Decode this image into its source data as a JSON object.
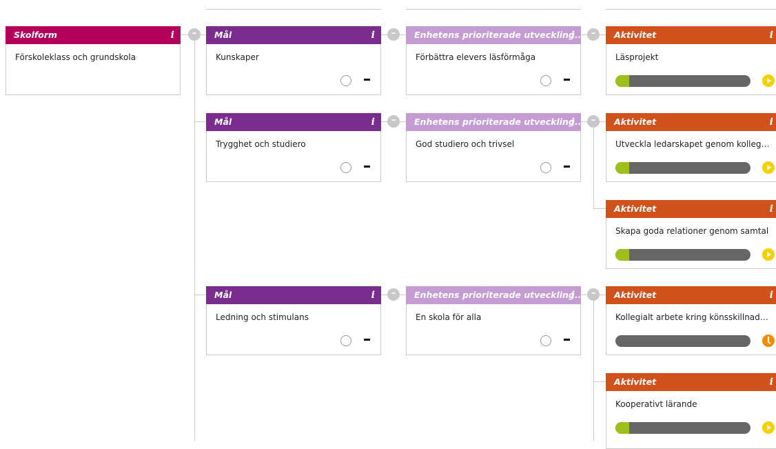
{
  "colors": {
    "skolform": "#b5005b",
    "mal": "#7b2d8e",
    "enhet": "#c49bd2",
    "aktivitet": "#d0511b",
    "progress_fill": "#9dbf1c",
    "progress_track": "#666666",
    "play": "#f5d000",
    "clock": "#f28c00"
  },
  "toggle_symbol": "–",
  "info_symbol": "i",
  "skolform": {
    "header": "Skolform",
    "text": "Förskoleklass och grundskola"
  },
  "mal": [
    {
      "header": "Mål",
      "text": "Kunskaper"
    },
    {
      "header": "Mål",
      "text": "Trygghet och studiero"
    },
    {
      "header": "Mål",
      "text": "Ledning och stimulans"
    }
  ],
  "enhet": [
    {
      "header": "Enhetens prioriterade utveckling...",
      "text": "Förbättra elevers läsförmåga"
    },
    {
      "header": "Enhetens prioriterade utveckling...",
      "text": "God studiero och trivsel"
    },
    {
      "header": "Enhetens prioriterade utveckling...",
      "text": "En skola för alla"
    }
  ],
  "aktivitet": [
    {
      "header": "Aktivitet",
      "text": "Läsprojekt",
      "progress": 0.1,
      "status_icon": "play-icon"
    },
    {
      "header": "Aktivitet",
      "text": "Utveckla ledarskapet genom kollegia...",
      "progress": 0.1,
      "status_icon": "play-icon"
    },
    {
      "header": "Aktivitet",
      "text": "Skapa goda relationer genom samtal",
      "progress": 0.1,
      "status_icon": "play-icon"
    },
    {
      "header": "Aktivitet",
      "text": "Kollegialt arbete kring könsskillnade...",
      "progress": 0.0,
      "status_icon": "clock-icon"
    },
    {
      "header": "Aktivitet",
      "text": "Kooperativt lärande",
      "progress": 0.1,
      "status_icon": "play-icon"
    }
  ]
}
